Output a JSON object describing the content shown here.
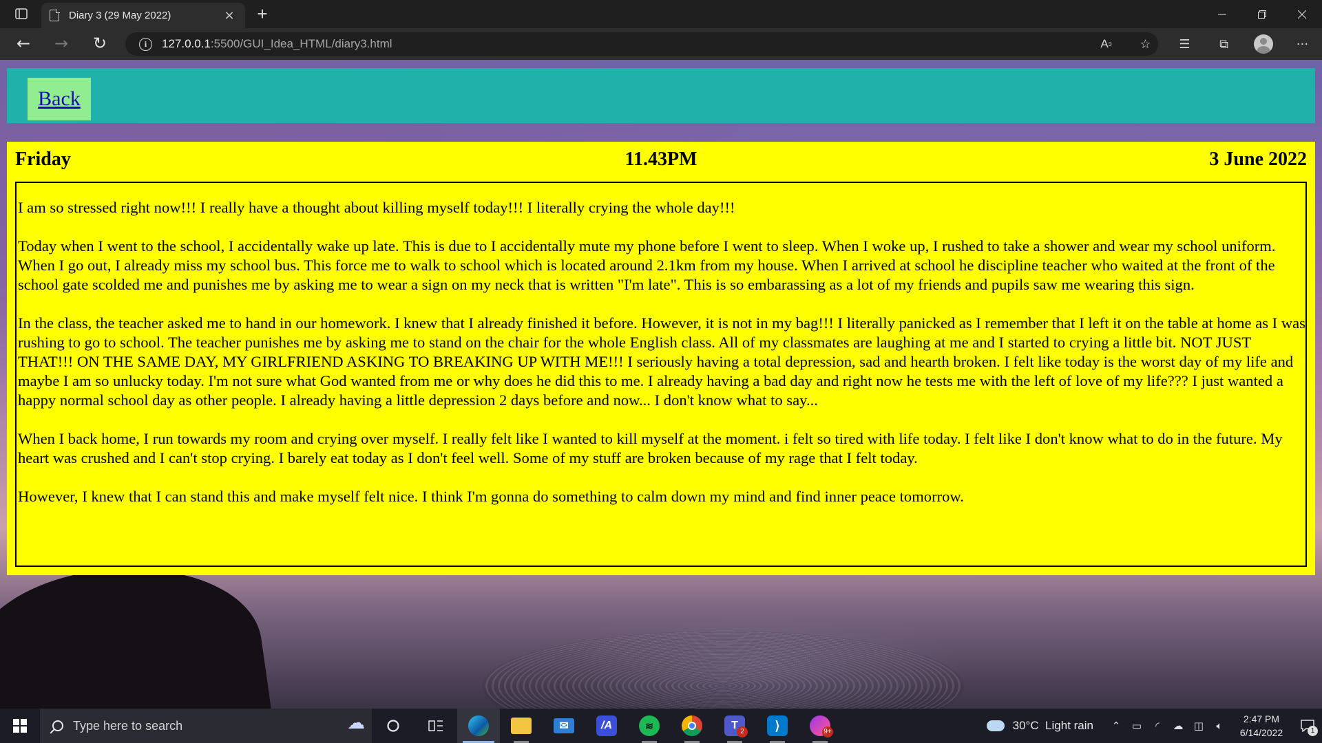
{
  "browser": {
    "tab_title": "Diary 3 (29 May 2022)",
    "tab_close": "×",
    "new_tab": "+",
    "url_host": "127.0.0.1",
    "url_path": ":5500/GUI_Idea_HTML/diary3.html",
    "icons": [
      "tab-actions-icon",
      "page-icon",
      "back-arrow-icon",
      "forward-arrow-icon",
      "refresh-icon",
      "info-icon",
      "read-aloud-icon",
      "add-favorite-icon",
      "favorites-icon",
      "collections-icon",
      "profile-avatar",
      "more-icon"
    ]
  },
  "page": {
    "back_label": "Back",
    "header_color": "#20b2aa",
    "back_button_color": "#90ee90",
    "diary_bg_color": "#ffff00",
    "day": "Friday",
    "time": "11.43PM",
    "date": "3 June 2022",
    "paragraphs": [
      "I am so stressed right now!!! I really have a thought about killing myself today!!! I literally crying the whole day!!!",
      "Today when I went to the school, I accidentally wake up late. This is due to I accidentally mute my phone before I went to sleep. When I woke up, I rushed to take a shower and wear my school uniform. When I go out, I already miss my school bus. This force me to walk to school which is located around 2.1km from my house. When I arrived at school he discipline teacher who waited at the front of the school gate scolded me and punishes me by asking me to wear a sign on my neck that is written \"I'm late\". This is so embarassing as a lot of my friends and pupils saw me wearing this sign.",
      "In the class, the teacher asked me to hand in our homework. I knew that I already finished it before. However, it is not in my bag!!! I literally panicked as I remember that I left it on the table at home as I was rushing to go to school. The teacher punishes me by asking me to stand on the chair for the whole English class. All of my classmates are laughing at me and I started to crying a little bit. NOT JUST THAT!!! ON THE SAME DAY, MY GIRLFRIEND ASKING TO BREAKING UP WITH ME!!! I seriously having a total depression, sad and hearth broken. I felt like today is the worst day of my life and maybe I am so unlucky today. I'm not sure what God wanted from me or why does he did this to me. I already having a bad day and right now he tests me with the left of love of my life??? I just wanted a happy normal school day as other people. I already having a little depression 2 days before and now... I don't know what to say...",
      "When I back home, I run towards my room and crying over myself. I really felt like I wanted to kill myself at the moment. i felt so tired with life today. I felt like I don't know what to do in the future. My heart was crushed and I can't stop crying. I barely eat today as I don't feel well. Some of my stuff are broken because of my rage that I felt today.",
      "However, I knew that I can stand this and make myself felt nice. I think I'm gonna do something to calm down my mind and find inner peace tomorrow."
    ]
  },
  "taskbar": {
    "search_placeholder": "Type here to search",
    "apps": [
      "task-view-icon",
      "cortana-icon",
      "edge-icon",
      "file-explorer-icon",
      "mail-icon",
      "app-icon",
      "spotify-icon",
      "chrome-icon",
      "teams-icon",
      "vscode-icon",
      "messenger-icon"
    ],
    "teams_badge": "2",
    "messenger_badge": "9+",
    "weather": "30°C  Light rain",
    "time": "2:47 PM",
    "date": "6/14/2022",
    "notification_count": "1"
  }
}
